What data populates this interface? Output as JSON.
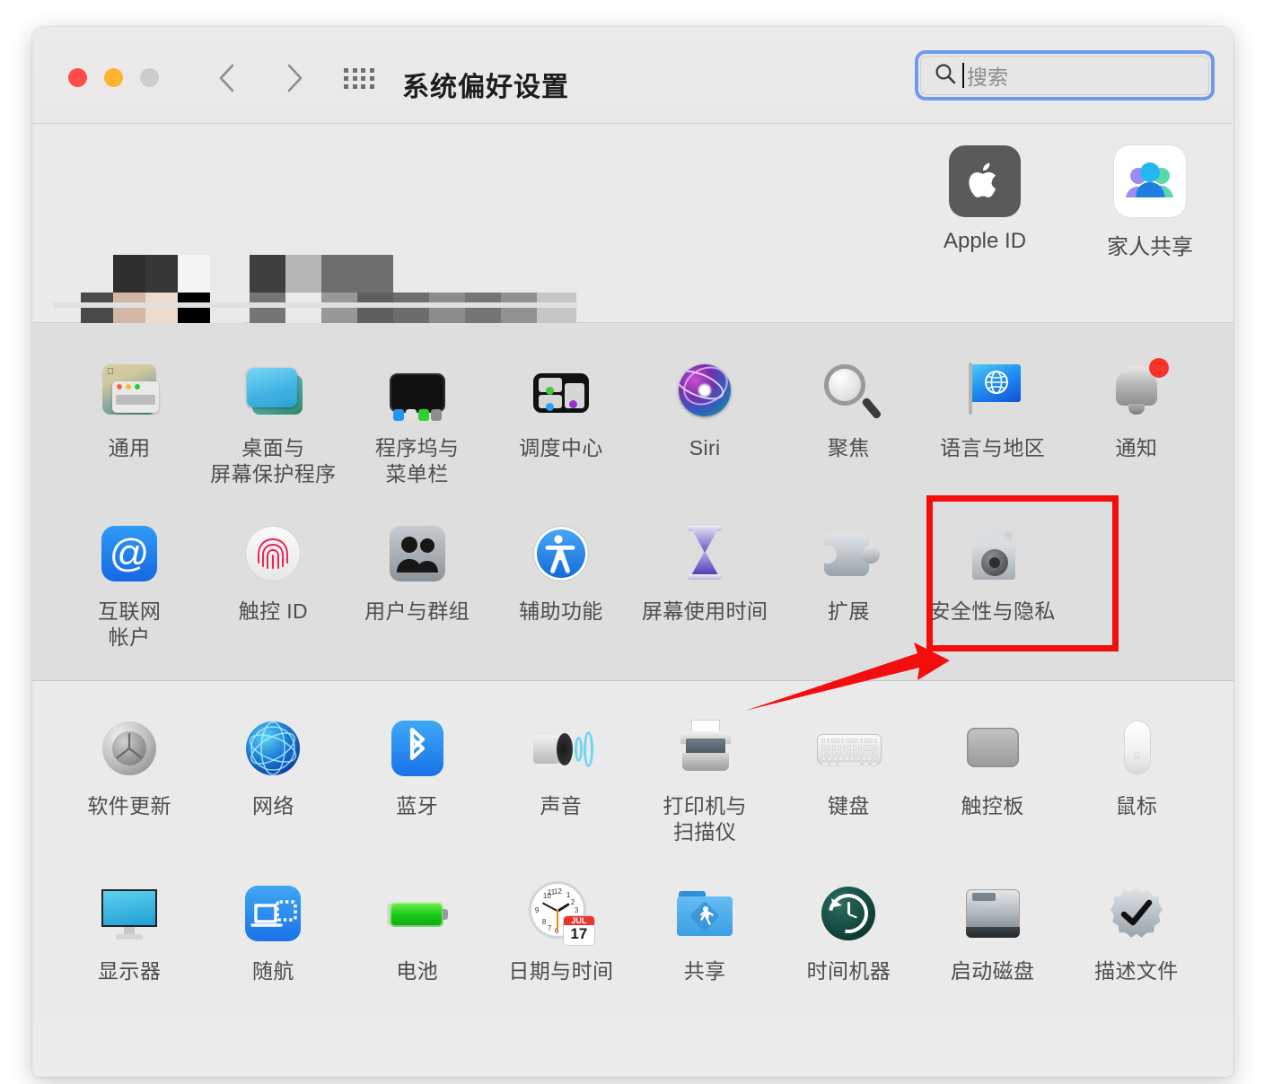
{
  "window": {
    "title": "系统偏好设置",
    "traffic_lights": [
      "close-red",
      "minimize-yellow",
      "zoom-gray-disabled"
    ],
    "nav_back": "‹",
    "nav_forward": "›",
    "grid_button": "show-all-grid-icon"
  },
  "search": {
    "placeholder": "搜索",
    "value": "",
    "focused": true,
    "focus_ring_color": "#6e9bec"
  },
  "banner": {
    "user_name_redacted": true,
    "user_avatar_redacted": true,
    "accounts": [
      {
        "label": "Apple ID",
        "icon": "apple-logo-icon"
      },
      {
        "label": "家人共享",
        "icon": "family-sharing-icon"
      }
    ]
  },
  "sections": [
    {
      "id": "personal-system",
      "rows": [
        [
          {
            "label": "通用",
            "label2": "",
            "icon": "general-icon"
          },
          {
            "label": "桌面与",
            "label2": "屏幕保护程序",
            "icon": "desktop-screensaver-icon"
          },
          {
            "label": "程序坞与",
            "label2": "菜单栏",
            "icon": "dock-menubar-icon"
          },
          {
            "label": "调度中心",
            "label2": "",
            "icon": "mission-control-icon"
          },
          {
            "label": "Siri",
            "label2": "",
            "icon": "siri-icon"
          },
          {
            "label": "聚焦",
            "label2": "",
            "icon": "spotlight-icon"
          },
          {
            "label": "语言与地区",
            "label2": "",
            "icon": "language-region-icon"
          },
          {
            "label": "通知",
            "label2": "",
            "icon": "notifications-bell-icon",
            "badge": true
          }
        ],
        [
          {
            "label": "互联网",
            "label2": "帐户",
            "icon": "internet-accounts-icon"
          },
          {
            "label": "触控 ID",
            "label2": "",
            "icon": "touch-id-icon"
          },
          {
            "label": "用户与群组",
            "label2": "",
            "icon": "users-groups-icon"
          },
          {
            "label": "辅助功能",
            "label2": "",
            "icon": "accessibility-icon"
          },
          {
            "label": "屏幕使用时间",
            "label2": "",
            "icon": "screen-time-icon"
          },
          {
            "label": "扩展",
            "label2": "",
            "icon": "extensions-icon"
          },
          {
            "label": "安全性与隐私",
            "label2": "",
            "icon": "security-privacy-icon",
            "highlighted": true
          }
        ]
      ]
    },
    {
      "id": "hardware-system",
      "rows": [
        [
          {
            "label": "软件更新",
            "label2": "",
            "icon": "software-update-icon"
          },
          {
            "label": "网络",
            "label2": "",
            "icon": "network-icon"
          },
          {
            "label": "蓝牙",
            "label2": "",
            "icon": "bluetooth-icon"
          },
          {
            "label": "声音",
            "label2": "",
            "icon": "sound-icon"
          },
          {
            "label": "打印机与",
            "label2": "扫描仪",
            "icon": "printers-scanners-icon"
          },
          {
            "label": "键盘",
            "label2": "",
            "icon": "keyboard-icon"
          },
          {
            "label": "触控板",
            "label2": "",
            "icon": "trackpad-icon"
          },
          {
            "label": "鼠标",
            "label2": "",
            "icon": "mouse-icon"
          }
        ],
        [
          {
            "label": "显示器",
            "label2": "",
            "icon": "displays-icon"
          },
          {
            "label": "随航",
            "label2": "",
            "icon": "sidecar-icon"
          },
          {
            "label": "电池",
            "label2": "",
            "icon": "battery-icon"
          },
          {
            "label": "日期与时间",
            "label2": "",
            "icon": "date-time-icon"
          },
          {
            "label": "共享",
            "label2": "",
            "icon": "sharing-icon"
          },
          {
            "label": "时间机器",
            "label2": "",
            "icon": "time-machine-icon"
          },
          {
            "label": "启动磁盘",
            "label2": "",
            "icon": "startup-disk-icon"
          },
          {
            "label": "描述文件",
            "label2": "",
            "icon": "profiles-icon"
          }
        ]
      ]
    }
  ],
  "date_time_icon": {
    "month": "JUL",
    "day": "17"
  },
  "annotations": {
    "highlight_box_color": "#f40d0d",
    "arrow_color": "#f40d0d",
    "arrow_points_to": "安全性与隐私"
  }
}
